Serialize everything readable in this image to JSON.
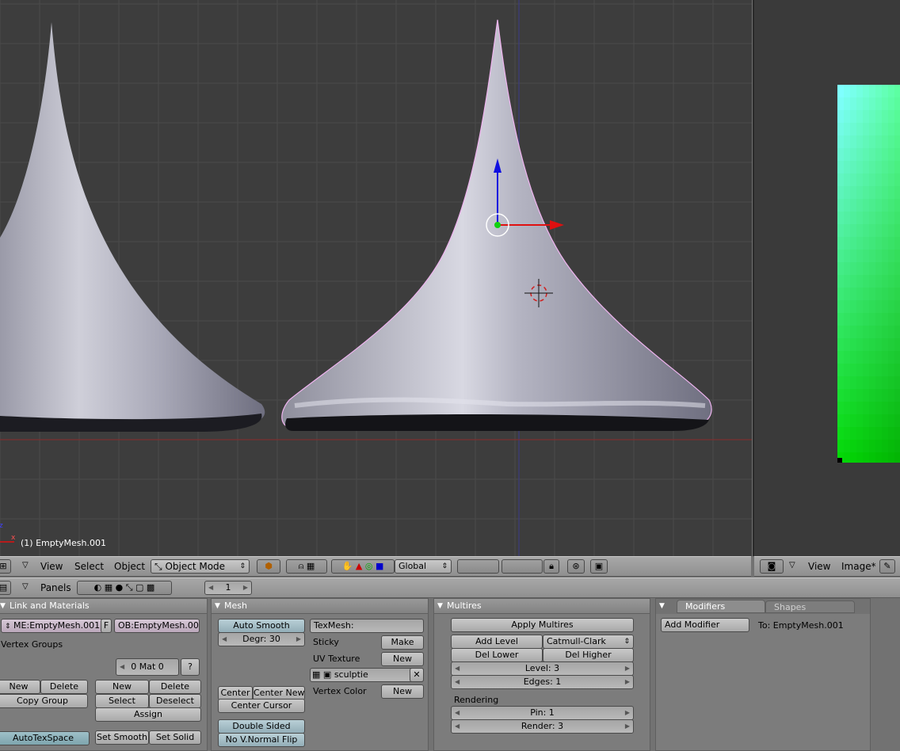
{
  "viewport": {
    "object_info": "(1) EmptyMesh.001",
    "axis_label": "z",
    "axis_x_label": "x"
  },
  "viewport_header": {
    "menus": [
      "View",
      "Select",
      "Object"
    ],
    "mode": "Object Mode",
    "orientation": "Global"
  },
  "image_header": {
    "menus": [
      "View",
      "Image*"
    ]
  },
  "buttons_header": {
    "panels_label": "Panels",
    "frame": "1"
  },
  "link_materials": {
    "title": "Link and Materials",
    "mesh_name": "ME:EmptyMesh.001",
    "f_label": "F",
    "object_name": "OB:EmptyMesh.001",
    "vertex_groups_label": "Vertex Groups",
    "mat_label": "0 Mat 0",
    "help_label": "?",
    "new_label": "New",
    "delete_label": "Delete",
    "copy_group_label": "Copy Group",
    "mat_new_label": "New",
    "mat_delete_label": "Delete",
    "select_label": "Select",
    "deselect_label": "Deselect",
    "assign_label": "Assign",
    "autotexspace_label": "AutoTexSpace",
    "set_smooth_label": "Set Smooth",
    "set_solid_label": "Set Solid"
  },
  "mesh": {
    "title": "Mesh",
    "auto_smooth_label": "Auto Smooth",
    "degr_label": "Degr: 30",
    "texmesh_label": "TexMesh:",
    "sticky_label": "Sticky",
    "make_label": "Make",
    "uv_texture_label": "UV Texture",
    "uv_new_label": "New",
    "uv_name": "sculptie",
    "vertex_color_label": "Vertex Color",
    "vc_new_label": "New",
    "center_label": "Center",
    "center_new_label": "Center New",
    "center_cursor_label": "Center Cursor",
    "double_sided_label": "Double Sided",
    "no_vnormal_flip_label": "No V.Normal Flip"
  },
  "multires": {
    "title": "Multires",
    "apply_label": "Apply Multires",
    "add_level_label": "Add Level",
    "subdiv_type": "Catmull-Clark",
    "del_lower_label": "Del Lower",
    "del_higher_label": "Del Higher",
    "level_label": "Level: 3",
    "edges_label": "Edges: 1",
    "rendering_label": "Rendering",
    "pin_label": "Pin: 1",
    "render_label": "Render: 3"
  },
  "modifiers": {
    "tab_modifiers": "Modifiers",
    "tab_shapes": "Shapes",
    "add_modifier_label": "Add Modifier",
    "to_label": "To: EmptyMesh.001"
  },
  "colors": {
    "viewport_bg": "#3d3d3d",
    "grid": "#4a4a4a",
    "mesh_fill": "#a7a7b4",
    "selection_outline": "#f0b4f0",
    "x_axis": "#e01010",
    "z_axis": "#1010e0",
    "uv_top": "#7fffff",
    "uv_bottom": "#00ee00"
  }
}
